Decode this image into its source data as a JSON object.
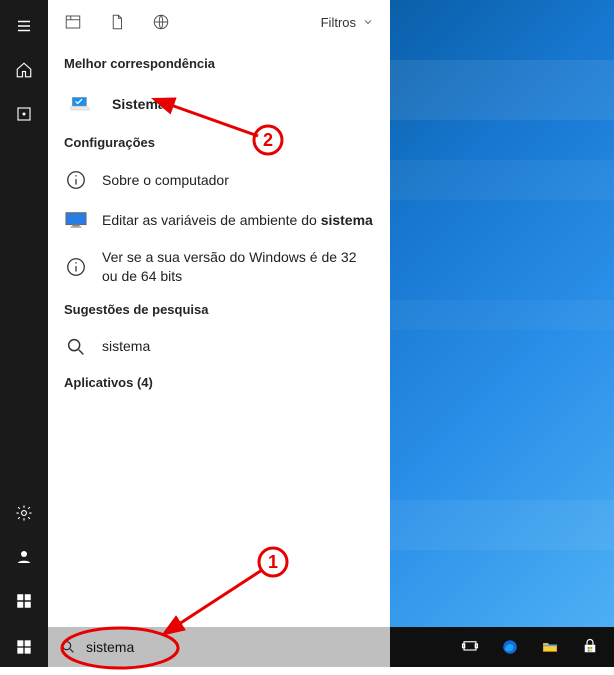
{
  "filters_label": "Filtros",
  "sections": {
    "best_match": "Melhor correspondência",
    "settings": "Configurações",
    "suggestions": "Sugestões de pesquisa",
    "apps": "Aplicativos (4)"
  },
  "best_match": {
    "title": "Sistema"
  },
  "settings_items": [
    {
      "text": "Sobre o computador",
      "icon": "info"
    },
    {
      "prefix": "Editar as variáveis de ambiente do ",
      "bold": "sistema",
      "icon": "monitor"
    },
    {
      "text": "Ver se a sua versão do Windows é de 32 ou de 64 bits",
      "icon": "info"
    }
  ],
  "suggestion": {
    "text": "sistema"
  },
  "search": {
    "value": "sistema"
  },
  "annotations": {
    "label1": "1",
    "label2": "2"
  },
  "colors": {
    "annotation": "#e60000",
    "taskbar_search_bg": "#bfbfbf",
    "rail_bg": "#1a1a1a"
  }
}
